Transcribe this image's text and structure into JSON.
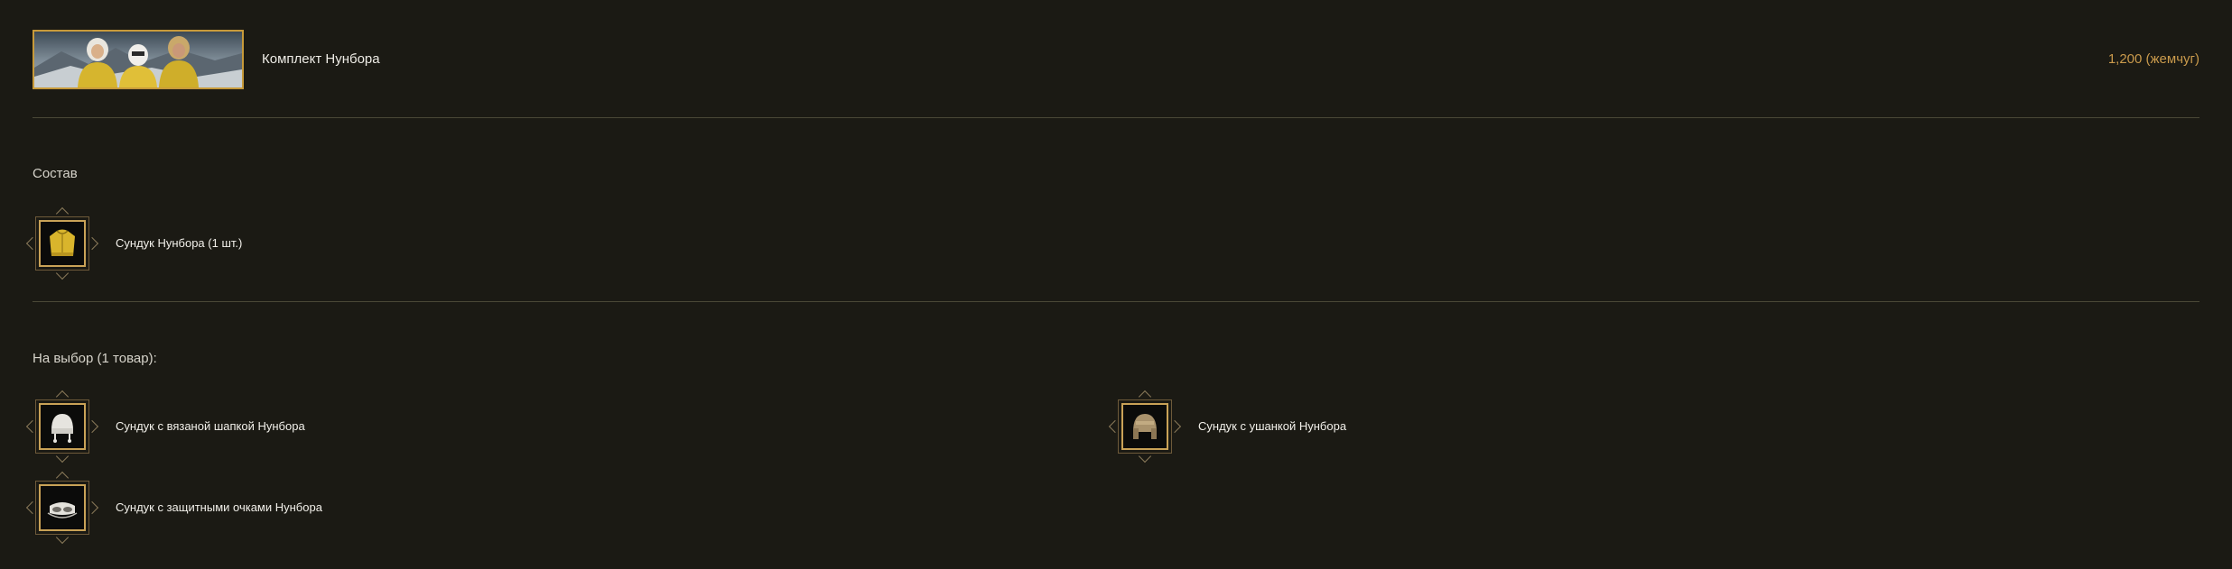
{
  "header": {
    "title": "Комплект Нунбора",
    "price": "1,200 (жемчуг)"
  },
  "composition": {
    "label": "Состав",
    "items": [
      {
        "label": "Сундук Нунбора (1 шт.)",
        "icon": "yellow-jacket-icon"
      }
    ]
  },
  "choice": {
    "label": "На выбор (1 товар):",
    "items": [
      {
        "label": "Сундук с вязаной шапкой Нунбора",
        "icon": "knit-hat-icon"
      },
      {
        "label": "Сундук с ушанкой Нунбора",
        "icon": "fur-hat-icon"
      },
      {
        "label": "Сундук с защитными очками Нунбора",
        "icon": "goggles-icon"
      }
    ]
  },
  "colors": {
    "background": "#1b1a14",
    "price": "#c99a4c",
    "frame_gold": "#c9a257"
  }
}
